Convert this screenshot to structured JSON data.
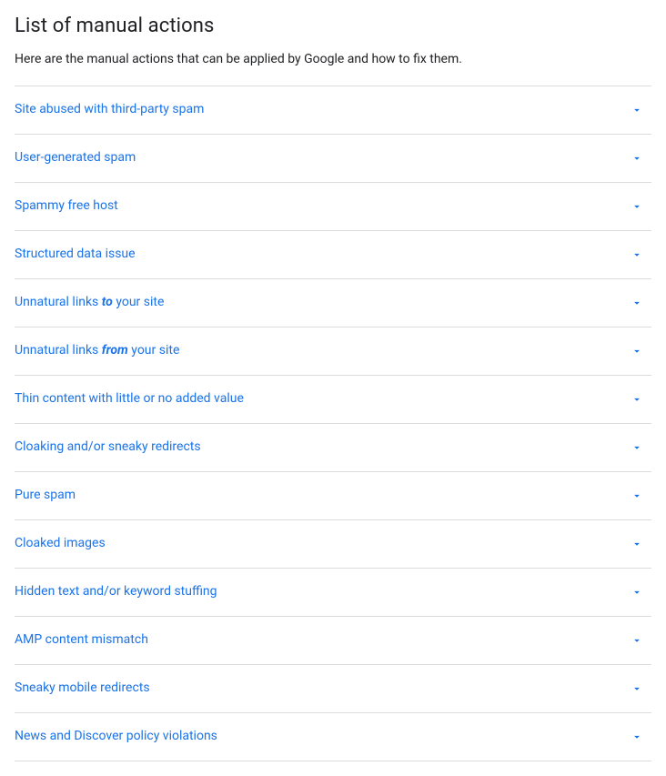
{
  "title": "List of manual actions",
  "description": "Here are the manual actions that can be applied by Google and how to fix them.",
  "items": [
    {
      "label": "Site abused with third-party spam"
    },
    {
      "label": "User-generated spam"
    },
    {
      "label": "Spammy free host"
    },
    {
      "label": "Structured data issue"
    },
    {
      "label_html": "Unnatural links <em>to</em> your site"
    },
    {
      "label_html": "Unnatural links <em>from</em> your site"
    },
    {
      "label": "Thin content with little or no added value"
    },
    {
      "label": "Cloaking and/or sneaky redirects"
    },
    {
      "label": "Pure spam"
    },
    {
      "label": "Cloaked images"
    },
    {
      "label": "Hidden text and/or keyword stuffing"
    },
    {
      "label": "AMP content mismatch"
    },
    {
      "label": "Sneaky mobile redirects"
    },
    {
      "label": "News and Discover policy violations"
    }
  ]
}
